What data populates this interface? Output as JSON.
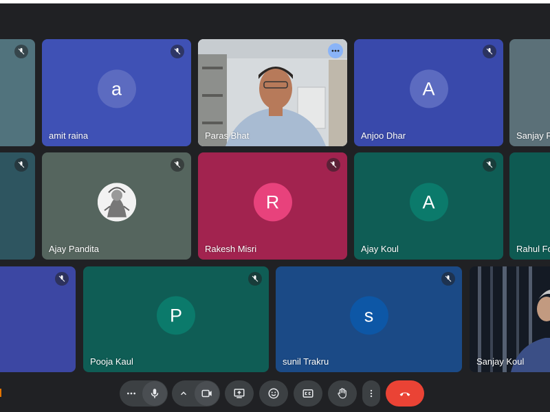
{
  "tiles": [
    {
      "id": "t1",
      "name": "",
      "initial": "",
      "bg": "#51737d"
    },
    {
      "id": "t2",
      "name": "amit raina",
      "initial": "a",
      "bg": "#3f51b5",
      "avatar_bg": "#5c6bc0"
    },
    {
      "id": "t3",
      "name": "Paras Bhat",
      "initial": "",
      "bg": "#cfd4d8",
      "active": true
    },
    {
      "id": "t4",
      "name": "Anjoo Dhar",
      "initial": "A",
      "bg": "#3949ab",
      "avatar_bg": "#5c6bc0"
    },
    {
      "id": "t5",
      "name": "Sanjay Ra",
      "initial": "",
      "bg": "#5b7078"
    },
    {
      "id": "t6",
      "name": "",
      "initial": "",
      "bg": "#2e5560"
    },
    {
      "id": "t7",
      "name": "Ajay Pandita",
      "initial": "",
      "bg": "#55655e"
    },
    {
      "id": "t8",
      "name": "Rakesh Misri",
      "initial": "R",
      "bg": "#a2234f",
      "avatar_bg": "#e8427c"
    },
    {
      "id": "t9",
      "name": "Ajay Koul",
      "initial": "A",
      "bg": "#0f5d55",
      "avatar_bg": "#0b7a6b"
    },
    {
      "id": "t10",
      "name": "Rahul Fo",
      "initial": "",
      "bg": "#0e5a52"
    },
    {
      "id": "t11",
      "name": "",
      "initial": "",
      "bg": "#3c47a3"
    },
    {
      "id": "t12",
      "name": "Pooja Kaul",
      "initial": "P",
      "bg": "#0f5d55",
      "avatar_bg": "#0b7a6b"
    },
    {
      "id": "t13",
      "name": "sunil Trakru",
      "initial": "s",
      "bg": "#1b4a86",
      "avatar_bg": "#0d57a6"
    },
    {
      "id": "t14",
      "name": "Sanjay Koul",
      "initial": "",
      "bg": "#1d2430"
    }
  ],
  "controls": {
    "more_options_icon": "more-horizontal-icon",
    "mic_icon": "microphone-icon",
    "expand_icon": "chevron-up-icon",
    "camera_icon": "camera-icon",
    "present_icon": "present-screen-icon",
    "emoji_icon": "emoji-icon",
    "captions_icon": "captions-icon",
    "raise_hand_icon": "raise-hand-icon",
    "more_vert_icon": "more-vertical-icon",
    "end_call_icon": "end-call-icon",
    "end_call_color": "#ea4335"
  }
}
